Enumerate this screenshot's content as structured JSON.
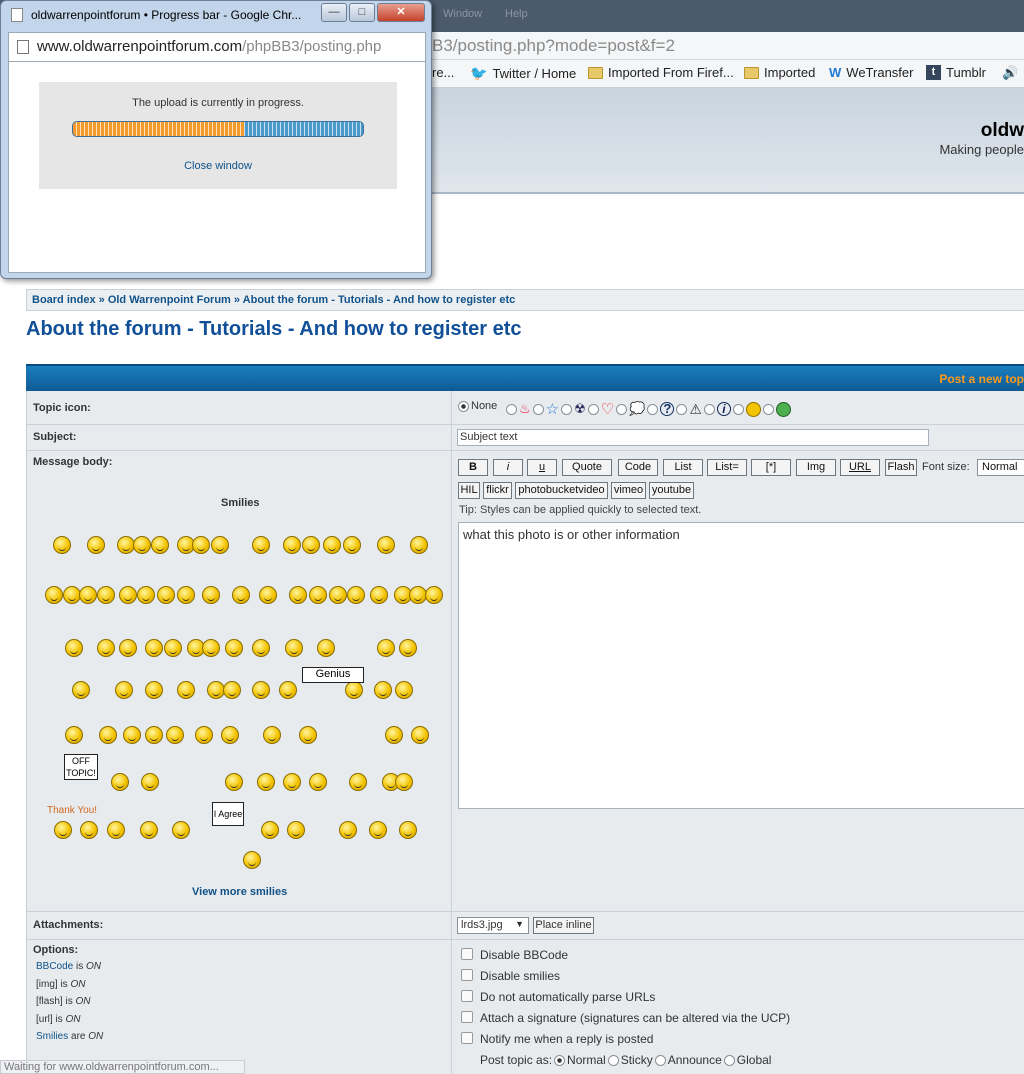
{
  "popup": {
    "title": "oldwarrenpointforum • Progress bar - Google Chr...",
    "url_domain": "www.oldwarrenpointforum.com",
    "url_path": "/phpBB3/posting.php",
    "message": "The upload is currently in progress.",
    "progress": 0.59,
    "close_label": "Close window",
    "minimize": "—",
    "maximize": "□",
    "close": "✕"
  },
  "browser": {
    "menu_items": [
      "Window",
      "Help"
    ],
    "url_tail": "B3/posting.php?mode=post&f=2",
    "bookmarks": [
      {
        "label": "re...",
        "icon": "none"
      },
      {
        "label": "Twitter / Home",
        "icon": "twitter-icon"
      },
      {
        "label": "Imported From Firef...",
        "icon": "folder-icon"
      },
      {
        "label": "Imported",
        "icon": "folder-icon"
      },
      {
        "label": "WeTransfer",
        "icon": "wetransfer-icon"
      },
      {
        "label": "Tumblr",
        "icon": "tumblr-icon"
      }
    ],
    "status": "Waiting for www.oldwarrenpointforum.com..."
  },
  "forum": {
    "site_title": "oldw",
    "site_desc": "Making people",
    "breadcrumb": [
      "Board index",
      "Old Warrenpoint Forum",
      "About the forum - Tutorials - And how to register etc"
    ],
    "breadcrumb_sep": " » ",
    "page_title": "About the forum - Tutorials - And how to register etc",
    "post_new": "Post a new top"
  },
  "form": {
    "topic_icon_label": "Topic icon:",
    "none_label": "None",
    "subject_label": "Subject:",
    "subject_value": "Subject text",
    "message_label": "Message body:",
    "smilies_title": "Smilies",
    "view_more": "View more smilies",
    "genius": "Genius",
    "off_topic": "OFF TOPIC!",
    "thank_you": "Thank You!",
    "i_agree": "I Agree",
    "bbcode_buttons": [
      "B",
      "i",
      "u",
      "Quote",
      "Code",
      "List",
      "List=",
      "[*]",
      "Img",
      "URL",
      "Flash"
    ],
    "font_size_label": "Font size:",
    "font_size_value": "Normal",
    "custom_buttons": [
      "HIL",
      "flickr",
      "photobucketvideo",
      "vimeo",
      "youtube"
    ],
    "tip": "Tip: Styles can be applied quickly to selected text.",
    "message_value": "what this photo is or other information",
    "attachments_label": "Attachments:",
    "attachment_file": "lrds3.jpg",
    "place_inline": "Place inline",
    "options_label": "Options:",
    "options_status": [
      {
        "name": "BBCode",
        "suffix": " is ",
        "state": "ON"
      },
      {
        "name": "[img]",
        "suffix": " is ",
        "state": "ON"
      },
      {
        "name": "[flash]",
        "suffix": " is ",
        "state": "ON"
      },
      {
        "name": "[url]",
        "suffix": " is ",
        "state": "ON"
      },
      {
        "name": "Smilies",
        "suffix": " are ",
        "state": "ON"
      }
    ],
    "checkboxes": [
      "Disable BBCode",
      "Disable smilies",
      "Do not automatically parse URLs",
      "Attach a signature (signatures can be altered via the UCP)",
      "Notify me when a reply is posted"
    ],
    "post_topic_as": "Post topic as:",
    "topic_types": [
      "Normal",
      "Sticky",
      "Announce",
      "Global"
    ]
  }
}
